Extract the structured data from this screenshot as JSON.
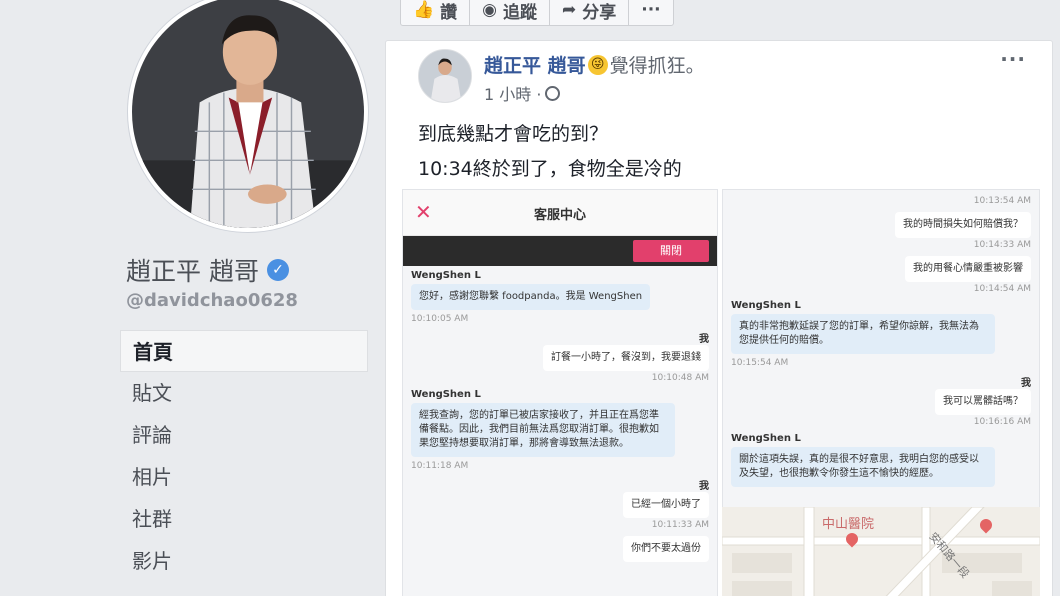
{
  "profile": {
    "name": "趙正平 趙哥",
    "verified_mark": "✓",
    "handle": "@davidchao0628"
  },
  "nav": {
    "items": [
      {
        "label": "首頁",
        "active": true
      },
      {
        "label": "貼文"
      },
      {
        "label": "評論"
      },
      {
        "label": "相片"
      },
      {
        "label": "社群"
      },
      {
        "label": "影片"
      }
    ]
  },
  "actionbar": {
    "like": {
      "icon": "👍",
      "label": "讚"
    },
    "follow": {
      "icon": "◉",
      "label": "追蹤"
    },
    "share": {
      "icon": "➦",
      "label": "分享"
    },
    "more": "···"
  },
  "post": {
    "author": "趙正平 趙哥",
    "feeling": "覺得抓狂。",
    "emoji": "😜",
    "time": "1 小時 ·",
    "more": "···",
    "lines": [
      "到底幾點才會吃的到？",
      "10:34終於到了，食物全是冷的"
    ]
  },
  "chat_left": {
    "header_title": "客服中心",
    "close_x": "✕",
    "close_button": "關閉",
    "agent1": "WengShen L",
    "msg1": "您好，感謝您聯繫 foodpanda。我是 WengShen",
    "ts1": "10:10:05 AM",
    "me1": "我",
    "reply1": "訂餐一小時了，餐沒到，我要退錢",
    "ts2": "10:10:48 AM",
    "agent2": "WengShen L",
    "msg2": "經我查詢，您的訂單已被店家接收了，并且正在爲您準備餐點。因此，我們目前無法爲您取消訂單。很抱歉如果您堅持想要取消訂單，那將會導致無法退款。",
    "ts3": "10:11:18 AM",
    "me2": "我",
    "reply2": "已經一個小時了",
    "ts4": "10:11:33 AM",
    "reply3": "你們不要太過份"
  },
  "chat_right": {
    "ts0": "10:13:54 AM",
    "r1": "我的時間損失如何賠償我？",
    "ts1": "10:14:33 AM",
    "r2": "我的用餐心情嚴重被影響",
    "ts2": "10:14:54 AM",
    "agent1": "WengShen L",
    "m1": "真的非常抱歉延誤了您的訂單，希望你諒解，我無法為您提供任何的賠償。",
    "ts3": "10:15:54 AM",
    "me": "我",
    "r3": "我可以罵髒話嗎？",
    "ts4": "10:16:16 AM",
    "agent2": "WengShen L",
    "m2": "關於這項失誤，真的是很不好意思，我明白您的感受以及失望，也很抱歉令你發生這不愉快的經歷。"
  },
  "map": {
    "label": "中山醫院",
    "road": "安和路一段"
  },
  "colors": {
    "link": "#365899",
    "accent": "#e2406c",
    "verified": "#4a90e2"
  }
}
